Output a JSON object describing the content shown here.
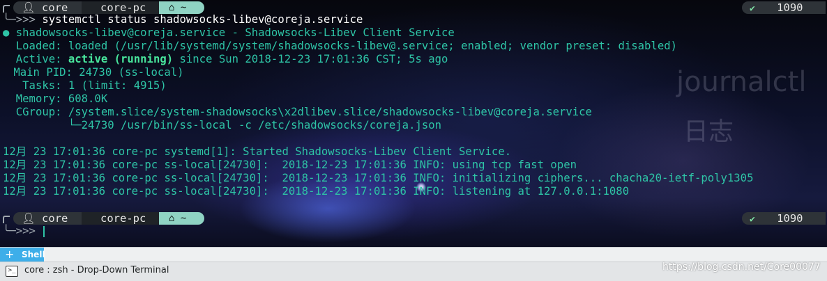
{
  "prompt_top": {
    "user": "core",
    "host": "core-pc",
    "dir": "~",
    "right_status": "1090"
  },
  "prompt_bottom": {
    "user": "core",
    "host": "core-pc",
    "dir": "~",
    "right_status": "1090"
  },
  "ps2": "╰─>>>",
  "command": "systemctl status shadowsocks-libev@coreja.service",
  "output": {
    "unit_line": "● shadowsocks-libev@coreja.service - Shadowsocks-Libev Client Service",
    "loaded": "  Loaded: loaded (/usr/lib/systemd/system/shadowsocks-libev@.service; enabled; vendor preset: disabled)",
    "active_prefix": "  Active: ",
    "active_status": "active (running)",
    "active_suffix": " since Sun 2018-12-23 17:01:36 CST; 5s ago",
    "main_pid": " Main PID: 24730 (ss-local)",
    "tasks": "   Tasks: 1 (limit: 4915)",
    "memory": "  Memory: 608.0K",
    "cgroup": "  CGroup: /system.slice/system-shadowsocks\\x2dlibev.slice/shadowsocks-libev@coreja.service",
    "cgroup_child": "          └─24730 /usr/bin/ss-local -c /etc/shadowsocks/coreja.json",
    "log": [
      "12月 23 17:01:36 core-pc systemd[1]: Started Shadowsocks-Libev Client Service.",
      "12月 23 17:01:36 core-pc ss-local[24730]:  2018-12-23 17:01:36 INFO: using tcp fast open",
      "12月 23 17:01:36 core-pc ss-local[24730]:  2018-12-23 17:01:36 INFO: initializing ciphers... chacha20-ietf-poly1305",
      "12月 23 17:01:36 core-pc ss-local[24730]:  2018-12-23 17:01:36 INFO: listening at 127.0.0.1:1080"
    ]
  },
  "background_text": {
    "heading": "journalctl",
    "subheading": "日志"
  },
  "tab_label": "Shell",
  "window_title": "core : zsh - Drop-Down Terminal",
  "watermark": "https://blog.csdn.net/Core00077",
  "icons": {
    "user": "user-icon",
    "home": "home-icon",
    "check": "check-icon",
    "new_tab": "plus-icon",
    "terminal": "terminal-icon"
  },
  "colors": {
    "output": "#2ec4a6",
    "active": "#48e59c",
    "tab": "#3daee9",
    "dir_segment": "#8fd3c3"
  }
}
